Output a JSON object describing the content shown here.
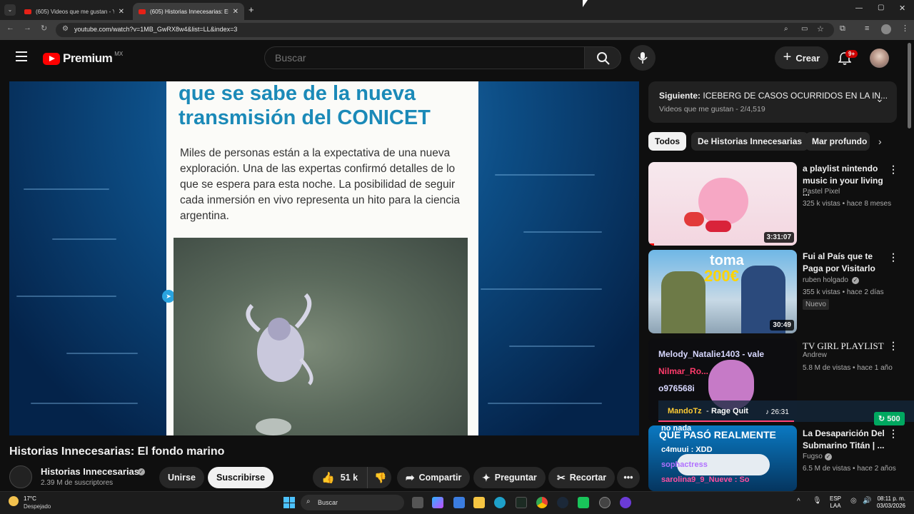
{
  "browser": {
    "tabs": [
      {
        "label": "(605) Videos que me gustan - Y"
      },
      {
        "label": "(605) Historias Innecesarias: El f"
      }
    ],
    "url": "youtube.com/watch?v=1MB_GwRX8w4&list=LL&index=3"
  },
  "header": {
    "logo": "Premium",
    "region": "MX",
    "search_placeholder": "Buscar",
    "create_label": "Crear",
    "notif_badge": "9+"
  },
  "video": {
    "card_title": "que se sabe de la nueva transmisión del CONICET",
    "card_body": "Miles de personas están a la expectativa de una nueva exploración. Una de las expertas confirmó detalles de lo que se espera para esta noche. La posibilidad de seguir cada inmersión en vivo representa un hito para la ciencia argentina.",
    "title": "Historias Innecesarias: El fondo marino",
    "channel": "Historias Innecesarias",
    "subscribers": "2.39 M de suscriptores",
    "join_label": "Unirse",
    "subscribe_label": "Suscribirse",
    "likes": "51 k",
    "share_label": "Compartir",
    "ask_label": "Preguntar",
    "clip_label": "Recortar"
  },
  "sidebar": {
    "up_next_prefix": "Siguiente:",
    "up_next_title": "ICEBERG DE CASOS OCURRIDOS EN LA IN...",
    "up_next_meta": "Videos que me gustan - 2/4,519",
    "chips": [
      "Todos",
      "De Historias Innecesarias",
      "Mar profundo"
    ],
    "items": [
      {
        "title": "a playlist nintendo music in your living ...",
        "channel": "Pastel Pixel",
        "meta": "325 k vistas • hace 8 meses",
        "duration": "3:31:07"
      },
      {
        "title": "Fui al País que te Paga por Visitarlo",
        "channel": "ruben holgado",
        "meta": "355 k vistas • hace 2 días",
        "duration": "30:49",
        "badge": "Nuevo",
        "thumb_text_top": "toma",
        "thumb_text_bottom": "200€"
      },
      {
        "title": "TV GIRL PLAYLIST",
        "channel": "Andrew",
        "meta": "5.8 M de vistas • hace 1 año"
      },
      {
        "title": "La Desaparición Del Submarino Titán | ...",
        "channel": "Fugso",
        "meta": "6.5 M de vistas • hace 2 años",
        "thumb_text": "QUE PASÓ REALMENTE"
      }
    ]
  },
  "overlay": {
    "lines": [
      "Melody_Natalie1403 - vale",
      "Nilmar_Ro...",
      "o976568i",
      "no nada",
      "c4muui : XDD",
      "sophactress",
      "sarolina9_9_Nueve : So"
    ],
    "song_user": "MandoTz",
    "song_title": "Rage Quit",
    "song_time": "♪ 26:31",
    "points": "500"
  },
  "taskbar": {
    "temp": "17°C",
    "weather": "Despejado",
    "search_label": "Buscar",
    "lang": "ESP",
    "lang2": "LAA",
    "time": "08:11 p. m.",
    "date": "03/03/2026"
  }
}
